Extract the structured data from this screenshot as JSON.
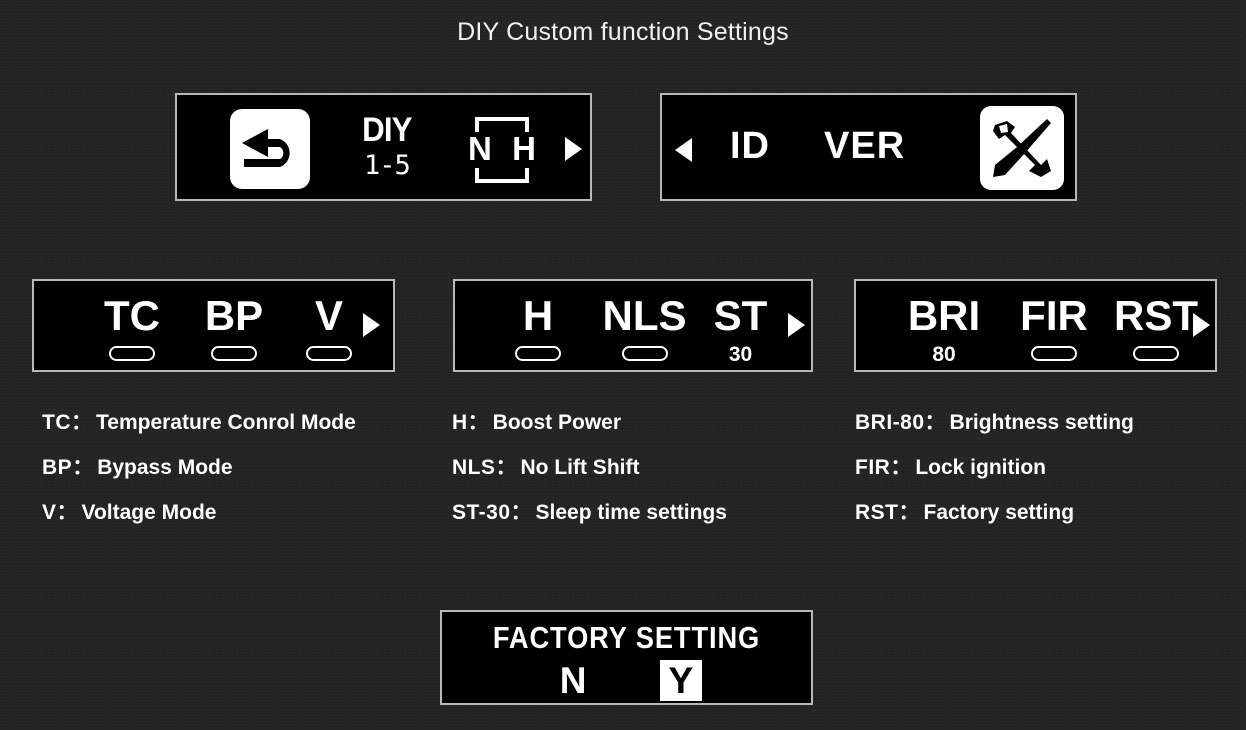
{
  "page": {
    "title": "DIY Custom function Settings",
    "background_color": "#242424",
    "screen_color": "#000000",
    "text_color": "#ffffff",
    "screen_border_color": "#b8b8b8"
  },
  "panels": {
    "diy": {
      "back_icon": "return-arrow-icon",
      "diy_label": "DIY",
      "diy_range": "1-5",
      "nh_left": "N",
      "nh_right": "H",
      "next_arrow": "triangle-right-icon"
    },
    "idver": {
      "prev_arrow": "triangle-left-icon",
      "id_label": "ID",
      "ver_label": "VER",
      "tools_icon": "wrench-screwdriver-icon"
    },
    "modes": {
      "slots": [
        {
          "label": "TC",
          "indicator": "pill",
          "value": ""
        },
        {
          "label": "BP",
          "indicator": "pill",
          "value": ""
        },
        {
          "label": "V",
          "indicator": "pill",
          "value": ""
        }
      ],
      "next_arrow": "triangle-right-icon"
    },
    "power": {
      "slots": [
        {
          "label": "H",
          "indicator": "pill",
          "value": ""
        },
        {
          "label": "NLS",
          "indicator": "pill",
          "value": ""
        },
        {
          "label": "ST",
          "indicator": "value",
          "value": "30"
        }
      ],
      "next_arrow": "triangle-right-icon"
    },
    "system": {
      "slots": [
        {
          "label": "BRI",
          "indicator": "value",
          "value": "80"
        },
        {
          "label": "FIR",
          "indicator": "pill",
          "value": ""
        },
        {
          "label": "RST",
          "indicator": "pill",
          "value": ""
        }
      ],
      "next_arrow": "triangle-right-icon"
    },
    "factory": {
      "title": "FACTORY SETTING",
      "options": [
        {
          "label": "N",
          "selected": false
        },
        {
          "label": "Y",
          "selected": true
        }
      ]
    }
  },
  "legend": {
    "column_1": [
      {
        "key": "TC",
        "sep": "：",
        "desc": "Temperature Conrol Mode"
      },
      {
        "key": "BP",
        "sep": "：",
        "desc": "Bypass Mode"
      },
      {
        "key": "V",
        "sep": "：",
        "desc": "Voltage Mode"
      }
    ],
    "column_2": [
      {
        "key": "H",
        "sep": "：",
        "desc": "Boost Power"
      },
      {
        "key": "NLS",
        "sep": "：",
        "desc": "No Lift Shift"
      },
      {
        "key": "ST-30",
        "sep": "：",
        "desc": "Sleep time settings"
      }
    ],
    "column_3": [
      {
        "key": "BRI-80",
        "sep": "：",
        "desc": "Brightness setting"
      },
      {
        "key": "FIR",
        "sep": "：",
        "desc": "Lock ignition"
      },
      {
        "key": "RST",
        "sep": "：",
        "desc": "Factory setting"
      }
    ]
  }
}
